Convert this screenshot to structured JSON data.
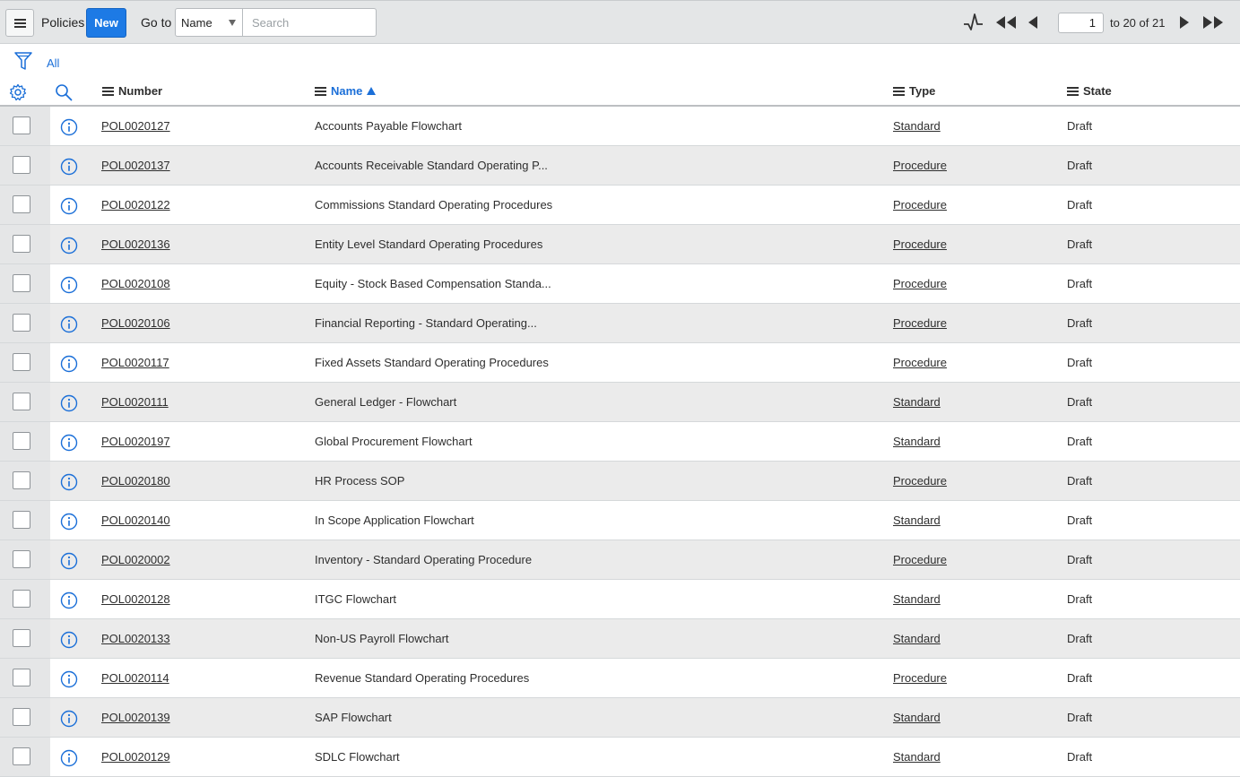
{
  "toolbar": {
    "title": "Policies",
    "new_label": "New",
    "goto_label": "Go to",
    "goto_field": "Name",
    "search_placeholder": "Search",
    "page_current": "1",
    "page_range": "to 20 of 21"
  },
  "filter": {
    "label": "All"
  },
  "columns": {
    "number": "Number",
    "name": "Name",
    "type": "Type",
    "state": "State",
    "sort_column": "name",
    "sort_direction": "ascending"
  },
  "colors": {
    "accent": "#1d7ae5",
    "link": "#1b6fd8",
    "toolbar_bg": "#e4e6e7"
  },
  "icons": {
    "menu": "hamburger-icon",
    "activity": "activity-stream-icon",
    "first": "first-page-icon",
    "prev": "previous-page-icon",
    "next": "next-page-icon",
    "last": "last-page-icon",
    "filter": "filter-icon",
    "settings": "gear-icon",
    "search": "search-icon",
    "info": "info-icon"
  },
  "rows": [
    {
      "number": "POL0020127",
      "name": "Accounts Payable Flowchart",
      "type": "Standard",
      "state": "Draft"
    },
    {
      "number": "POL0020137",
      "name": "Accounts Receivable Standard Operating P...",
      "type": "Procedure",
      "state": "Draft"
    },
    {
      "number": "POL0020122",
      "name": "Commissions Standard Operating Procedures",
      "type": "Procedure",
      "state": "Draft"
    },
    {
      "number": "POL0020136",
      "name": "Entity Level Standard Operating Procedures",
      "type": "Procedure",
      "state": "Draft"
    },
    {
      "number": "POL0020108",
      "name": "Equity - Stock Based Compensation Standa...",
      "type": "Procedure",
      "state": "Draft"
    },
    {
      "number": "POL0020106",
      "name": "Financial Reporting - Standard Operating...",
      "type": "Procedure",
      "state": "Draft"
    },
    {
      "number": "POL0020117",
      "name": "Fixed Assets Standard Operating Procedures",
      "type": "Procedure",
      "state": "Draft"
    },
    {
      "number": "POL0020111",
      "name": "General Ledger - Flowchart",
      "type": "Standard",
      "state": "Draft"
    },
    {
      "number": "POL0020197",
      "name": "Global Procurement Flowchart",
      "type": "Standard",
      "state": "Draft"
    },
    {
      "number": "POL0020180",
      "name": "HR Process SOP",
      "type": "Procedure",
      "state": "Draft"
    },
    {
      "number": "POL0020140",
      "name": "In Scope Application Flowchart",
      "type": "Standard",
      "state": "Draft"
    },
    {
      "number": "POL0020002",
      "name": "Inventory - Standard Operating Procedure",
      "type": "Procedure",
      "state": "Draft"
    },
    {
      "number": "POL0020128",
      "name": "ITGC Flowchart",
      "type": "Standard",
      "state": "Draft"
    },
    {
      "number": "POL0020133",
      "name": "Non-US Payroll Flowchart",
      "type": "Standard",
      "state": "Draft"
    },
    {
      "number": "POL0020114",
      "name": "Revenue Standard Operating Procedures",
      "type": "Procedure",
      "state": "Draft"
    },
    {
      "number": "POL0020139",
      "name": "SAP Flowchart",
      "type": "Standard",
      "state": "Draft"
    },
    {
      "number": "POL0020129",
      "name": "SDLC Flowchart",
      "type": "Standard",
      "state": "Draft"
    }
  ]
}
